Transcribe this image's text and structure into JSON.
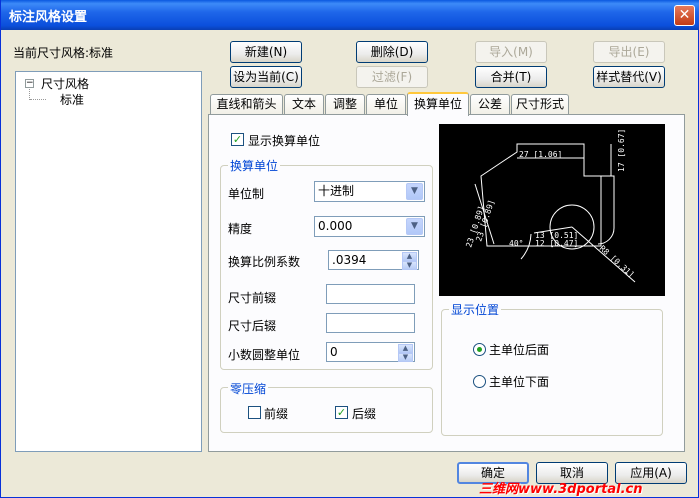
{
  "window": {
    "title": "标注风格设置",
    "close_glyph": "✕"
  },
  "current_style": {
    "label": "当前尺寸风格:标准"
  },
  "buttons": {
    "new": "新建(N)",
    "delete": "删除(D)",
    "import": "导入(M)",
    "export": "导出(E)",
    "set_current": "设为当前(C)",
    "filter": "过滤(F)",
    "merge": "合并(T)",
    "replace": "样式替代(V)"
  },
  "tree": {
    "root": "尺寸风格",
    "child": "标准",
    "expander_glyph": "−"
  },
  "tabs": [
    "直线和箭头",
    "文本",
    "调整",
    "单位",
    "换算单位",
    "公差",
    "尺寸形式"
  ],
  "active_tab": "换算单位",
  "panel": {
    "show_alt_units": {
      "label": "显示换算单位",
      "checked": true
    },
    "alt_units_group": {
      "title": "换算单位",
      "unit_format": {
        "label": "单位制",
        "value": "十进制"
      },
      "precision": {
        "label": "精度",
        "value": "0.000"
      },
      "scale": {
        "label": "换算比例系数",
        "value": ".0394"
      },
      "prefix": {
        "label": "尺寸前辍",
        "value": ""
      },
      "suffix": {
        "label": "尺寸后辍",
        "value": ""
      },
      "round": {
        "label": "小数圆整单位",
        "value": "0"
      }
    },
    "zero_suppress": {
      "title": "零压缩",
      "leading": {
        "label": "前缀",
        "checked": false
      },
      "trailing": {
        "label": "后缀",
        "checked": true
      }
    },
    "placement": {
      "title": "显示位置",
      "after": {
        "label": "主单位后面",
        "selected": true
      },
      "below": {
        "label": "主单位下面",
        "selected": false
      }
    },
    "preview_labels": [
      "27 [1.06]",
      "17 [0.67]",
      "R8 [0.31]",
      "23 [0.89]",
      "23 [0.89]",
      "40°",
      "12 [0.47]",
      "13 [0.51]"
    ]
  },
  "footer": {
    "ok": "确定",
    "cancel": "取消",
    "apply": "应用(A)"
  },
  "watermark": "三维网www.3dportal.cn",
  "colors": {
    "titlebar": "#0a58e0",
    "group_title": "#0046d5",
    "watermark": "#ff0000",
    "check": "#21a121"
  },
  "icons": {
    "close": "close-icon",
    "dropdown": "chevron-down-icon",
    "spin": "spin-arrows-icon",
    "check": "check-icon"
  }
}
